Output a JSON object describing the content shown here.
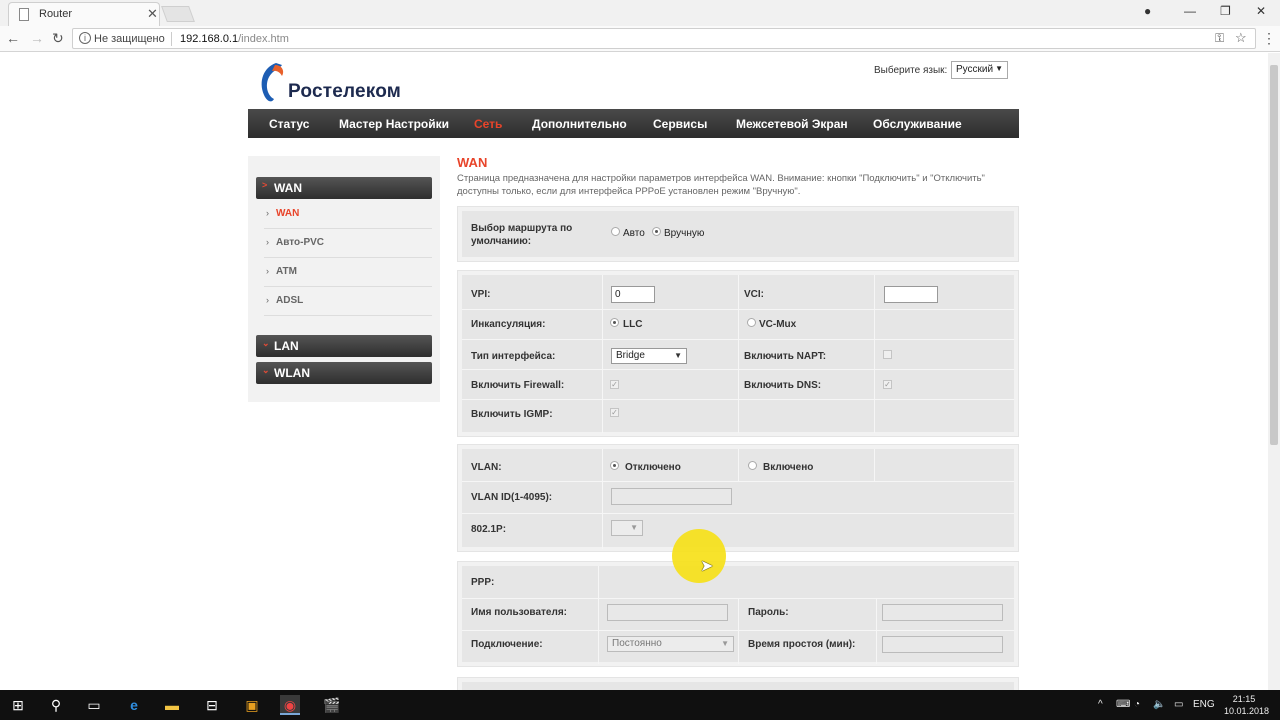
{
  "browser": {
    "tab_title": "Router",
    "security_label": "Не защищено",
    "url_host": "192.168.0.1",
    "url_path": "/index.htm"
  },
  "header": {
    "logo_text": "Ростелеком",
    "lang_label": "Выберите язык:",
    "lang_value": "Русский"
  },
  "nav": [
    {
      "label": "Статус"
    },
    {
      "label": "Мастер Настройки"
    },
    {
      "label": "Сеть"
    },
    {
      "label": "Дополнительно"
    },
    {
      "label": "Сервисы"
    },
    {
      "label": "Межсетевой Экран"
    },
    {
      "label": "Обслуживание"
    }
  ],
  "sidebar": {
    "groups": [
      {
        "label": "WAN"
      },
      {
        "label": "LAN"
      },
      {
        "label": "WLAN"
      }
    ],
    "items": [
      {
        "label": "WAN"
      },
      {
        "label": "Авто-PVC"
      },
      {
        "label": "ATM"
      },
      {
        "label": "ADSL"
      }
    ]
  },
  "main": {
    "title": "WAN",
    "description": "Страница предназначена для настройки параметров интерфейса WAN. Внимание: кнопки \"Подключить\" и \"Отключить\" доступны только, если для интерфейса PPPoE установлен режим \"Вручную\".",
    "route": {
      "label": "Выбор маршрута по умолчанию:",
      "opt_auto": "Авто",
      "opt_manual": "Вручную",
      "selected": "Вручную"
    },
    "atm": {
      "vpi_label": "VPI:",
      "vpi_value": "0",
      "vci_label": "VCI:",
      "vci_value": "",
      "encap_label": "Инкапсуляция:",
      "encap_llc": "LLC",
      "encap_vcmux": "VC-Mux",
      "encap_selected": "LLC",
      "iftype_label": "Тип интерфейса:",
      "iftype_value": "Bridge",
      "napt_label": "Включить NAPT:",
      "napt_checked": false,
      "firewall_label": "Включить Firewall:",
      "firewall_checked": true,
      "dns_label": "Включить DNS:",
      "dns_checked": true,
      "igmp_label": "Включить IGMP:",
      "igmp_checked": true
    },
    "vlan": {
      "label": "VLAN:",
      "opt_off": "Отключено",
      "opt_on": "Включено",
      "selected": "Отключено",
      "id_label": "VLAN ID(1-4095):",
      "id_value": "",
      "p_label": "802.1P:",
      "p_value": ""
    },
    "ppp": {
      "label": "PPP:",
      "user_label": "Имя пользователя:",
      "user_value": "",
      "pass_label": "Пароль:",
      "pass_value": "",
      "conn_label": "Подключение:",
      "conn_value": "Постоянно",
      "idle_label": "Время простоя (мин):",
      "idle_value": ""
    }
  },
  "taskbar": {
    "lang": "ENG",
    "time": "21:15",
    "date": "10.01.2018"
  }
}
